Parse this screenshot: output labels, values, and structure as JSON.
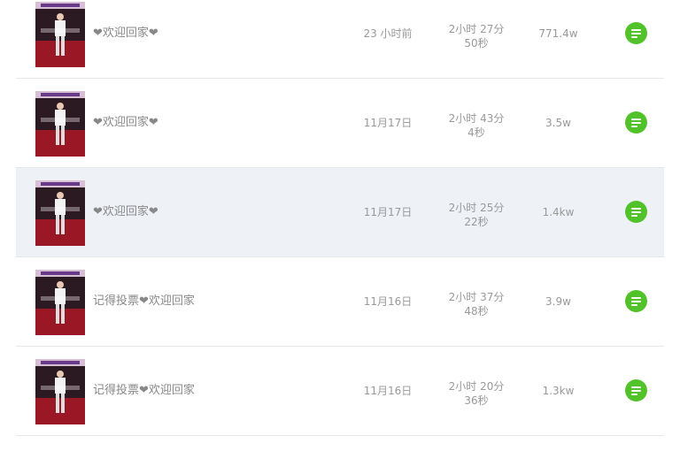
{
  "icons": {
    "action": "list-icon"
  },
  "colors": {
    "accent": "#52c22b",
    "row_hover": "#eef1f6",
    "text": "#999999"
  },
  "rows": [
    {
      "title": "❤欢迎回家❤",
      "time": "23 小时前",
      "duration_line1": "2小时 27分",
      "duration_line2": "50秒",
      "views": "771.4w"
    },
    {
      "title": "❤欢迎回家❤",
      "time": "11月17日",
      "duration_line1": "2小时 43分",
      "duration_line2": "4秒",
      "views": "3.5w"
    },
    {
      "title": "❤欢迎回家❤",
      "time": "11月17日",
      "duration_line1": "2小时 25分",
      "duration_line2": "22秒",
      "views": "1.4kw"
    },
    {
      "title": "记得投票❤欢迎回家",
      "time": "11月16日",
      "duration_line1": "2小时 37分",
      "duration_line2": "48秒",
      "views": "3.9w"
    },
    {
      "title": "记得投票❤欢迎回家",
      "time": "11月16日",
      "duration_line1": "2小时 20分",
      "duration_line2": "36秒",
      "views": "1.3kw"
    }
  ]
}
